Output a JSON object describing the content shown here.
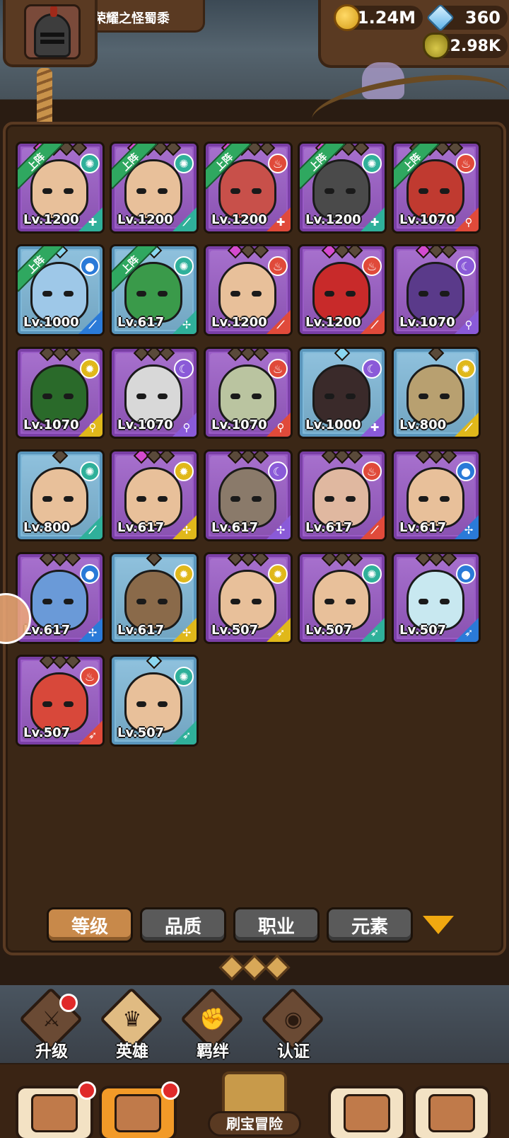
{
  "player": {
    "name": "荣耀之怪蜀黍"
  },
  "resources": {
    "gold": "1.24M",
    "gems": "360",
    "potion": "12.98K"
  },
  "heroes": [
    {
      "lv": "Lv.1200",
      "frame": "purple",
      "stars": [
        "g",
        "g",
        "n",
        "n"
      ],
      "lineup": true,
      "element": "wind",
      "cls": "shield",
      "skin": "#e8c09a"
    },
    {
      "lv": "Lv.1200",
      "frame": "purple",
      "stars": [
        "g",
        "n",
        "n",
        "n"
      ],
      "lineup": true,
      "element": "wind",
      "cls": "sword",
      "skin": "#e8c09a"
    },
    {
      "lv": "Lv.1200",
      "frame": "purple",
      "stars": [
        "g",
        "n",
        "n",
        "n"
      ],
      "lineup": true,
      "element": "fire",
      "cls": "shield",
      "skin": "#c8504a"
    },
    {
      "lv": "Lv.1200",
      "frame": "purple",
      "stars": [
        "g",
        "n",
        "n",
        "n"
      ],
      "lineup": true,
      "element": "wind",
      "cls": "shield",
      "skin": "#4a4a4a"
    },
    {
      "lv": "Lv.1070",
      "frame": "purple",
      "stars": [
        "n",
        "n",
        "n",
        "n"
      ],
      "lineup": true,
      "element": "fire",
      "cls": "staff",
      "skin": "#c03a30"
    },
    {
      "lv": "Lv.1000",
      "frame": "blue",
      "stars": [
        "c"
      ],
      "lineup": true,
      "element": "water",
      "cls": "sword",
      "skin": "#9ec8e8"
    },
    {
      "lv": "Lv.617",
      "frame": "blue",
      "stars": [
        "c"
      ],
      "lineup": true,
      "element": "wind",
      "cls": "dagger",
      "skin": "#3a9a4a"
    },
    {
      "lv": "Lv.1200",
      "frame": "purple",
      "stars": [
        "g",
        "n",
        "n"
      ],
      "lineup": false,
      "element": "fire",
      "cls": "sword",
      "skin": "#e8c09a"
    },
    {
      "lv": "Lv.1200",
      "frame": "purple",
      "stars": [
        "g",
        "n",
        "n"
      ],
      "lineup": false,
      "element": "fire",
      "cls": "sword",
      "skin": "#c82a2a"
    },
    {
      "lv": "Lv.1070",
      "frame": "purple",
      "stars": [
        "g",
        "n",
        "n"
      ],
      "lineup": false,
      "element": "dark",
      "cls": "staff",
      "skin": "#5a3a8a"
    },
    {
      "lv": "Lv.1070",
      "frame": "purple",
      "stars": [
        "n",
        "n",
        "n"
      ],
      "lineup": false,
      "element": "light",
      "cls": "staff",
      "skin": "#2a6a2a"
    },
    {
      "lv": "Lv.1070",
      "frame": "purple",
      "stars": [
        "n",
        "n",
        "n"
      ],
      "lineup": false,
      "element": "dark",
      "cls": "staff",
      "skin": "#d8d8d8"
    },
    {
      "lv": "Lv.1070",
      "frame": "purple",
      "stars": [
        "n",
        "n",
        "n"
      ],
      "lineup": false,
      "element": "fire",
      "cls": "staff",
      "skin": "#bac4a0"
    },
    {
      "lv": "Lv.1000",
      "frame": "blue",
      "stars": [
        "c"
      ],
      "lineup": false,
      "element": "dark",
      "cls": "shield",
      "skin": "#3a2a2a"
    },
    {
      "lv": "Lv.800",
      "frame": "blue",
      "stars": [
        "n"
      ],
      "lineup": false,
      "element": "light",
      "cls": "sword",
      "skin": "#b8a070"
    },
    {
      "lv": "Lv.800",
      "frame": "blue",
      "stars": [
        "n"
      ],
      "lineup": false,
      "element": "wind",
      "cls": "sword",
      "skin": "#e8c09a"
    },
    {
      "lv": "Lv.617",
      "frame": "purple",
      "stars": [
        "g",
        "n",
        "n"
      ],
      "lineup": false,
      "element": "light",
      "cls": "dagger",
      "skin": "#e8c09a"
    },
    {
      "lv": "Lv.617",
      "frame": "purple",
      "stars": [
        "n",
        "n",
        "n"
      ],
      "lineup": false,
      "element": "dark",
      "cls": "dagger",
      "skin": "#8a7a6a"
    },
    {
      "lv": "Lv.617",
      "frame": "purple",
      "stars": [
        "n",
        "n",
        "n"
      ],
      "lineup": false,
      "element": "fire",
      "cls": "sword",
      "skin": "#e0b8a0"
    },
    {
      "lv": "Lv.617",
      "frame": "purple",
      "stars": [
        "n",
        "n",
        "n"
      ],
      "lineup": false,
      "element": "water",
      "cls": "dagger",
      "skin": "#e8c09a"
    },
    {
      "lv": "Lv.617",
      "frame": "purple",
      "stars": [
        "n",
        "n",
        "n"
      ],
      "lineup": false,
      "element": "water",
      "cls": "dagger",
      "skin": "#6a9ad8"
    },
    {
      "lv": "Lv.617",
      "frame": "blue",
      "stars": [
        "n"
      ],
      "lineup": false,
      "element": "light",
      "cls": "dagger",
      "skin": "#8a6a4a"
    },
    {
      "lv": "Lv.507",
      "frame": "purple",
      "stars": [
        "n",
        "n",
        "n"
      ],
      "lineup": false,
      "element": "light",
      "cls": "bow",
      "skin": "#e8c09a"
    },
    {
      "lv": "Lv.507",
      "frame": "purple",
      "stars": [
        "n",
        "n",
        "n"
      ],
      "lineup": false,
      "element": "wind",
      "cls": "bow",
      "skin": "#e8c09a"
    },
    {
      "lv": "Lv.507",
      "frame": "purple",
      "stars": [
        "n",
        "n",
        "n"
      ],
      "lineup": false,
      "element": "water",
      "cls": "bow",
      "skin": "#c8e8f0"
    },
    {
      "lv": "Lv.507",
      "frame": "purple",
      "stars": [
        "n",
        "n",
        "n"
      ],
      "lineup": false,
      "element": "fire",
      "cls": "bow",
      "skin": "#d8483a"
    },
    {
      "lv": "Lv.507",
      "frame": "blue",
      "stars": [
        "c"
      ],
      "lineup": false,
      "element": "wind",
      "cls": "bow",
      "skin": "#e8c09a"
    }
  ],
  "lineup_label": "上阵",
  "filters": {
    "tabs": [
      "等级",
      "品质",
      "职业",
      "元素"
    ],
    "active": 0
  },
  "hero_nav": [
    {
      "label": "升级",
      "icon": "sword-icon",
      "badge": true
    },
    {
      "label": "英雄",
      "icon": "hero-icon",
      "badge": false,
      "active": true
    },
    {
      "label": "羁绊",
      "icon": "fist-icon",
      "badge": false
    },
    {
      "label": "认证",
      "icon": "eye-icon",
      "badge": false
    }
  ],
  "bottom_nav": [
    {
      "label": "",
      "icon": "shop-icon",
      "badge": true
    },
    {
      "label": "",
      "icon": "hero-portrait-icon",
      "badge": true,
      "active": true
    },
    {
      "label": "刷宝冒险",
      "icon": "map-compass-icon",
      "center": true
    },
    {
      "label": "",
      "icon": "backpack-icon",
      "badge": false
    },
    {
      "label": "",
      "icon": "hammer-icon",
      "badge": false
    }
  ],
  "colors": {
    "wind": "#2fb09a",
    "fire": "#e04a3a",
    "water": "#2a7ad8",
    "light": "#e0b81a",
    "dark": "#8a5ad8"
  }
}
